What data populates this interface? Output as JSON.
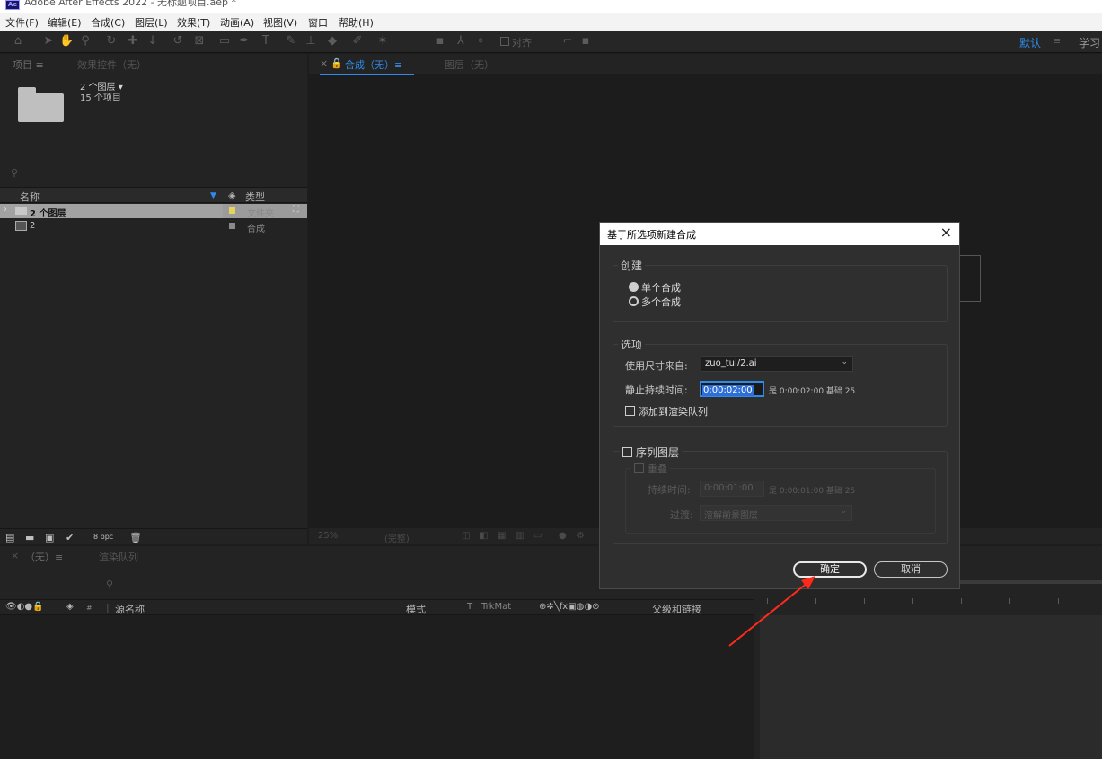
{
  "app": {
    "logo": "Ae",
    "title": "Adobe After Effects 2022 - 无标题项目.aep *"
  },
  "menu": [
    "文件(F)",
    "编辑(E)",
    "合成(C)",
    "图层(L)",
    "效果(T)",
    "动画(A)",
    "视图(V)",
    "窗口",
    "帮助(H)"
  ],
  "toolbar": {
    "snap_label": "对齐",
    "workspace": "默认",
    "workspace_menu": "≡",
    "learn": "学习"
  },
  "project": {
    "tabs": [
      "项目 ≡",
      "效果控件（无）"
    ],
    "selected_name": "2 个图层 ▾",
    "selected_count": "15 个项目",
    "columns": {
      "name": "名称",
      "type": "类型"
    },
    "items": [
      {
        "name": "2 个图层",
        "type": "文件夹",
        "label_color": "#e6d35a"
      },
      {
        "name": "2",
        "type": "合成",
        "label_color": "#8a8a8a"
      }
    ],
    "bpc": "8 bpc"
  },
  "viewer": {
    "tabs": [
      "合成（无）≡",
      "图层（无）"
    ],
    "zoom": "25%",
    "quality": "(完整)"
  },
  "timeline": {
    "tabs": [
      "（无）≡",
      "渲染队列"
    ],
    "columns": {
      "source_name": "源名称",
      "mode": "模式",
      "trkmat_t": "T",
      "trkmat": "TrkMat",
      "parent": "父级和链接"
    }
  },
  "dialog": {
    "title": "基于所选项新建合成",
    "create_group": "创建",
    "single": "单个合成",
    "multiple": "多个合成",
    "options_group": "选项",
    "size_from_label": "使用尺寸来自:",
    "size_from_value": "zuo_tui/2.ai",
    "still_duration_label": "静止持续时间:",
    "still_duration_value": "0:00:02:00",
    "still_duration_note": "是 0:00:02:00 基础 25",
    "add_render_queue": "添加到渲染队列",
    "sequence_group": "序列图层",
    "overlap": "重叠",
    "duration_label": "持续时间:",
    "duration_value": "0:00:01:00",
    "duration_note": "是 0:00:01:00 基础 25",
    "transition_label": "过渡:",
    "transition_value": "溶解前景图层",
    "ok": "确定",
    "cancel": "取消"
  },
  "colors": {
    "accent": "#2d8ceb",
    "annotation_arrow": "#ff2a1a"
  }
}
